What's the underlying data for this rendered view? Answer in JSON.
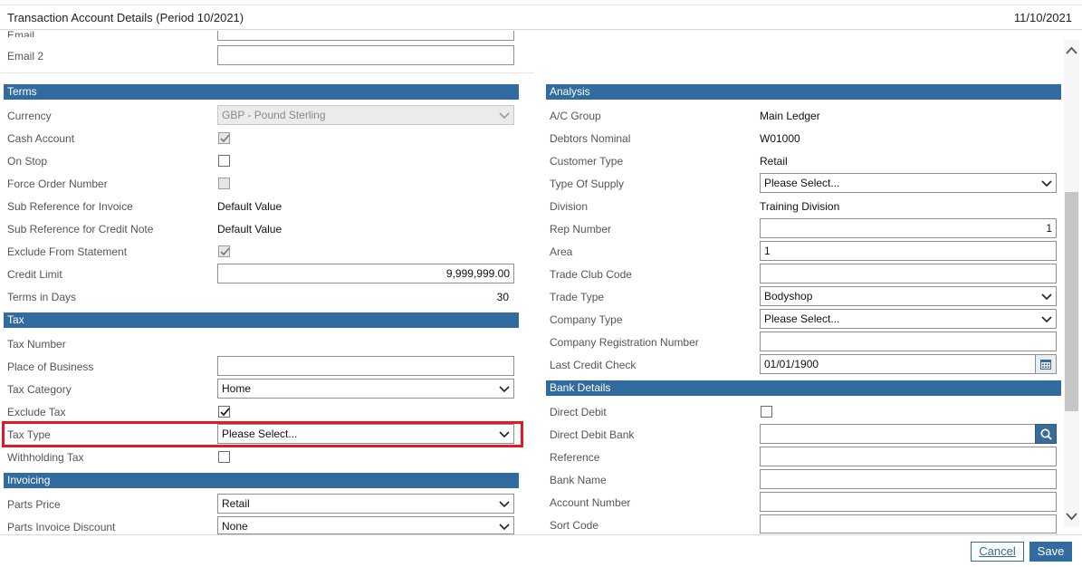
{
  "header": {
    "title": "Transaction Account Details (Period 10/2021)",
    "date": "11/10/2021"
  },
  "top": {
    "email_label": "Email",
    "email2_label": "Email 2"
  },
  "terms": {
    "title": "Terms",
    "currency_label": "Currency",
    "currency_value": "GBP - Pound Sterling",
    "cash_account_label": "Cash Account",
    "on_stop_label": "On Stop",
    "force_order_label": "Force Order Number",
    "sub_ref_invoice_label": "Sub Reference for Invoice",
    "sub_ref_invoice_value": "Default Value",
    "sub_ref_credit_label": "Sub Reference for Credit Note",
    "sub_ref_credit_value": "Default Value",
    "exclude_statement_label": "Exclude From Statement",
    "credit_limit_label": "Credit Limit",
    "credit_limit_value": "9,999,999.00",
    "terms_days_label": "Terms in Days",
    "terms_days_value": "30"
  },
  "tax": {
    "title": "Tax",
    "tax_number_label": "Tax Number",
    "place_business_label": "Place of Business",
    "tax_category_label": "Tax Category",
    "tax_category_value": "Home",
    "exclude_tax_label": "Exclude Tax",
    "tax_type_label": "Tax Type",
    "tax_type_value": "Please Select...",
    "withholding_label": "Withholding Tax"
  },
  "invoicing": {
    "title": "Invoicing",
    "parts_price_label": "Parts Price",
    "parts_price_value": "Retail",
    "parts_discount_label": "Parts Invoice Discount",
    "parts_discount_value": "None"
  },
  "analysis": {
    "title": "Analysis",
    "ac_group_label": "A/C Group",
    "ac_group_value": "Main Ledger",
    "debtors_label": "Debtors Nominal",
    "debtors_value": "W01000",
    "customer_type_label": "Customer Type",
    "customer_type_value": "Retail",
    "supply_label": "Type Of Supply",
    "supply_value": "Please Select...",
    "division_label": "Division",
    "division_value": "Training Division",
    "rep_label": "Rep Number",
    "rep_value": "1",
    "area_label": "Area",
    "area_value": "1",
    "trade_club_label": "Trade Club Code",
    "trade_type_label": "Trade Type",
    "trade_type_value": "Bodyshop",
    "company_type_label": "Company Type",
    "company_type_value": "Please Select...",
    "company_reg_label": "Company Registration Number",
    "last_credit_label": "Last Credit Check",
    "last_credit_value": "01/01/1900"
  },
  "bank": {
    "title": "Bank Details",
    "direct_debit_label": "Direct Debit",
    "dd_bank_label": "Direct Debit Bank",
    "reference_label": "Reference",
    "bank_name_label": "Bank Name",
    "account_number_label": "Account Number",
    "sort_code_label": "Sort Code"
  },
  "footer": {
    "cancel_label": "Cancel",
    "save_label": "Save"
  },
  "colors": {
    "section": "#316ba0",
    "highlight": "#e01b24"
  }
}
